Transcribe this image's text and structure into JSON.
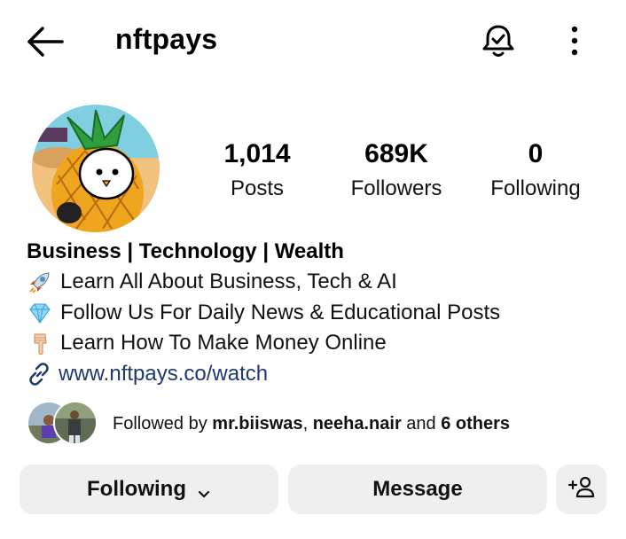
{
  "header": {
    "username": "nftpays"
  },
  "stats": [
    {
      "value": "1,014",
      "label": "Posts"
    },
    {
      "value": "689K",
      "label": "Followers"
    },
    {
      "value": "0",
      "label": "Following"
    }
  ],
  "bio": {
    "name": "Business | Technology | Wealth",
    "lines": [
      {
        "icon": "rocket-icon",
        "text": "Learn All About Business, Tech & AI"
      },
      {
        "icon": "gem-icon",
        "text": "Follow Us For Daily News & Educational Posts"
      },
      {
        "icon": "pointing-down-hand-icon",
        "text": "Learn How To Make Money Online"
      }
    ],
    "link": "www.nftpays.co/watch"
  },
  "followed_by": {
    "prefix": "Followed by ",
    "user1": "mr.biiswas",
    "sep": ", ",
    "user2": "neeha.nair",
    "and": " and ",
    "others": "6 others"
  },
  "buttons": {
    "following": "Following",
    "message": "Message"
  },
  "colors": {
    "link": "#1e3a6d",
    "button_bg": "#efefef"
  }
}
